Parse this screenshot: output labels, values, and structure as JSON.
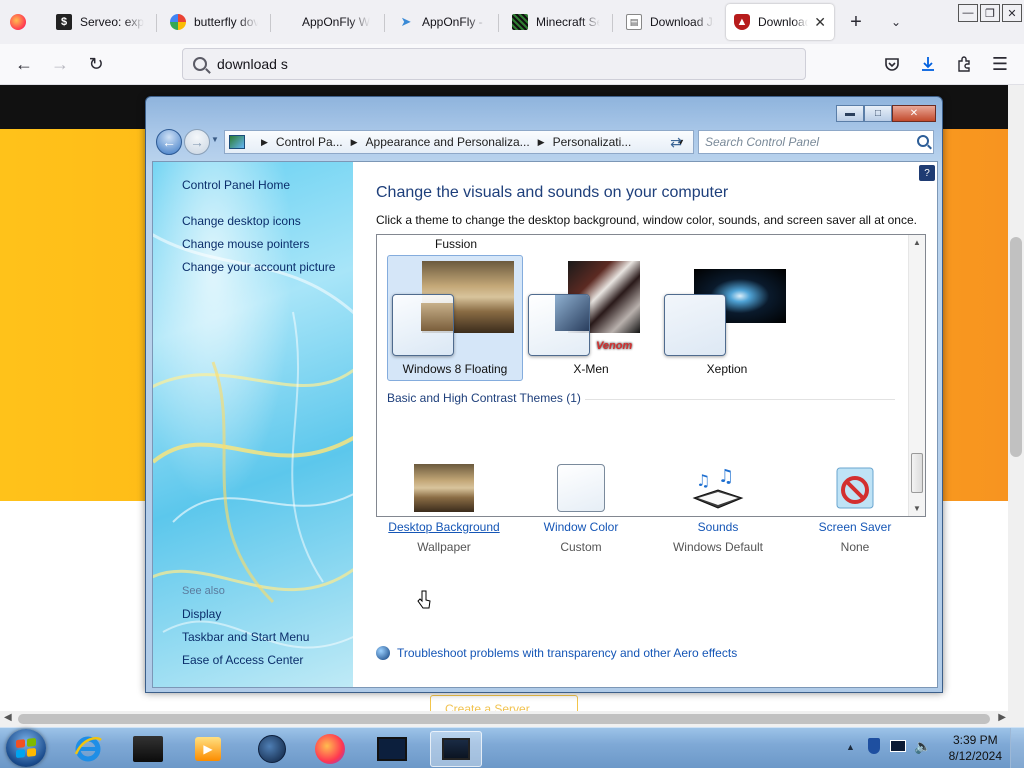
{
  "browser": {
    "tabs": [
      {
        "label": "",
        "icon": "firefox-icon"
      },
      {
        "label": "Serveo: expo",
        "icon": "dollar-icon"
      },
      {
        "label": "butterfly dov",
        "icon": "google-icon"
      },
      {
        "label": "AppOnFly W",
        "icon": "none"
      },
      {
        "label": "AppOnFly - I",
        "icon": "paper-plane-icon"
      },
      {
        "label": "Minecraft Se",
        "icon": "minecraft-icon"
      },
      {
        "label": "Download Ja",
        "icon": "page-icon"
      },
      {
        "label": "Download",
        "icon": "shield-icon",
        "active": true
      }
    ],
    "new_tab": "+",
    "url": "download s"
  },
  "page": {
    "ghost_button": "Create a Server"
  },
  "window": {
    "breadcrumb": [
      "Control Pa...",
      "Appearance and Personaliza...",
      "Personalizati..."
    ],
    "search_placeholder": "Search Control Panel",
    "left_links": [
      "Control Panel Home",
      "Change desktop icons",
      "Change mouse pointers",
      "Change your account picture"
    ],
    "see_also_label": "See also",
    "see_also_links": [
      "Display",
      "Taskbar and Start Menu",
      "Ease of Access Center"
    ],
    "title": "Change the visuals and sounds on your computer",
    "subtitle": "Click a theme to change the desktop background, window color, sounds, and screen saver all at once.",
    "group_label": "Fussion",
    "themes": [
      {
        "name": "Windows 8 Floating",
        "selected": true
      },
      {
        "name": "X-Men",
        "selected": false
      },
      {
        "name": "Xeption",
        "selected": false
      }
    ],
    "basic_group": "Basic and High Contrast Themes (1)",
    "options": [
      {
        "link": "Desktop Background",
        "value": "Wallpaper"
      },
      {
        "link": "Window Color",
        "value": "Custom"
      },
      {
        "link": "Sounds",
        "value": "Windows Default"
      },
      {
        "link": "Screen Saver",
        "value": "None"
      }
    ],
    "troubleshoot": "Troubleshoot problems with transparency and other Aero effects"
  },
  "taskbar": {
    "time": "3:39 PM",
    "date": "8/12/2024"
  },
  "colors": {
    "accent_link": "#1556b6",
    "title_blue": "#1e3f7b",
    "page_yellow": "#ffb014"
  }
}
